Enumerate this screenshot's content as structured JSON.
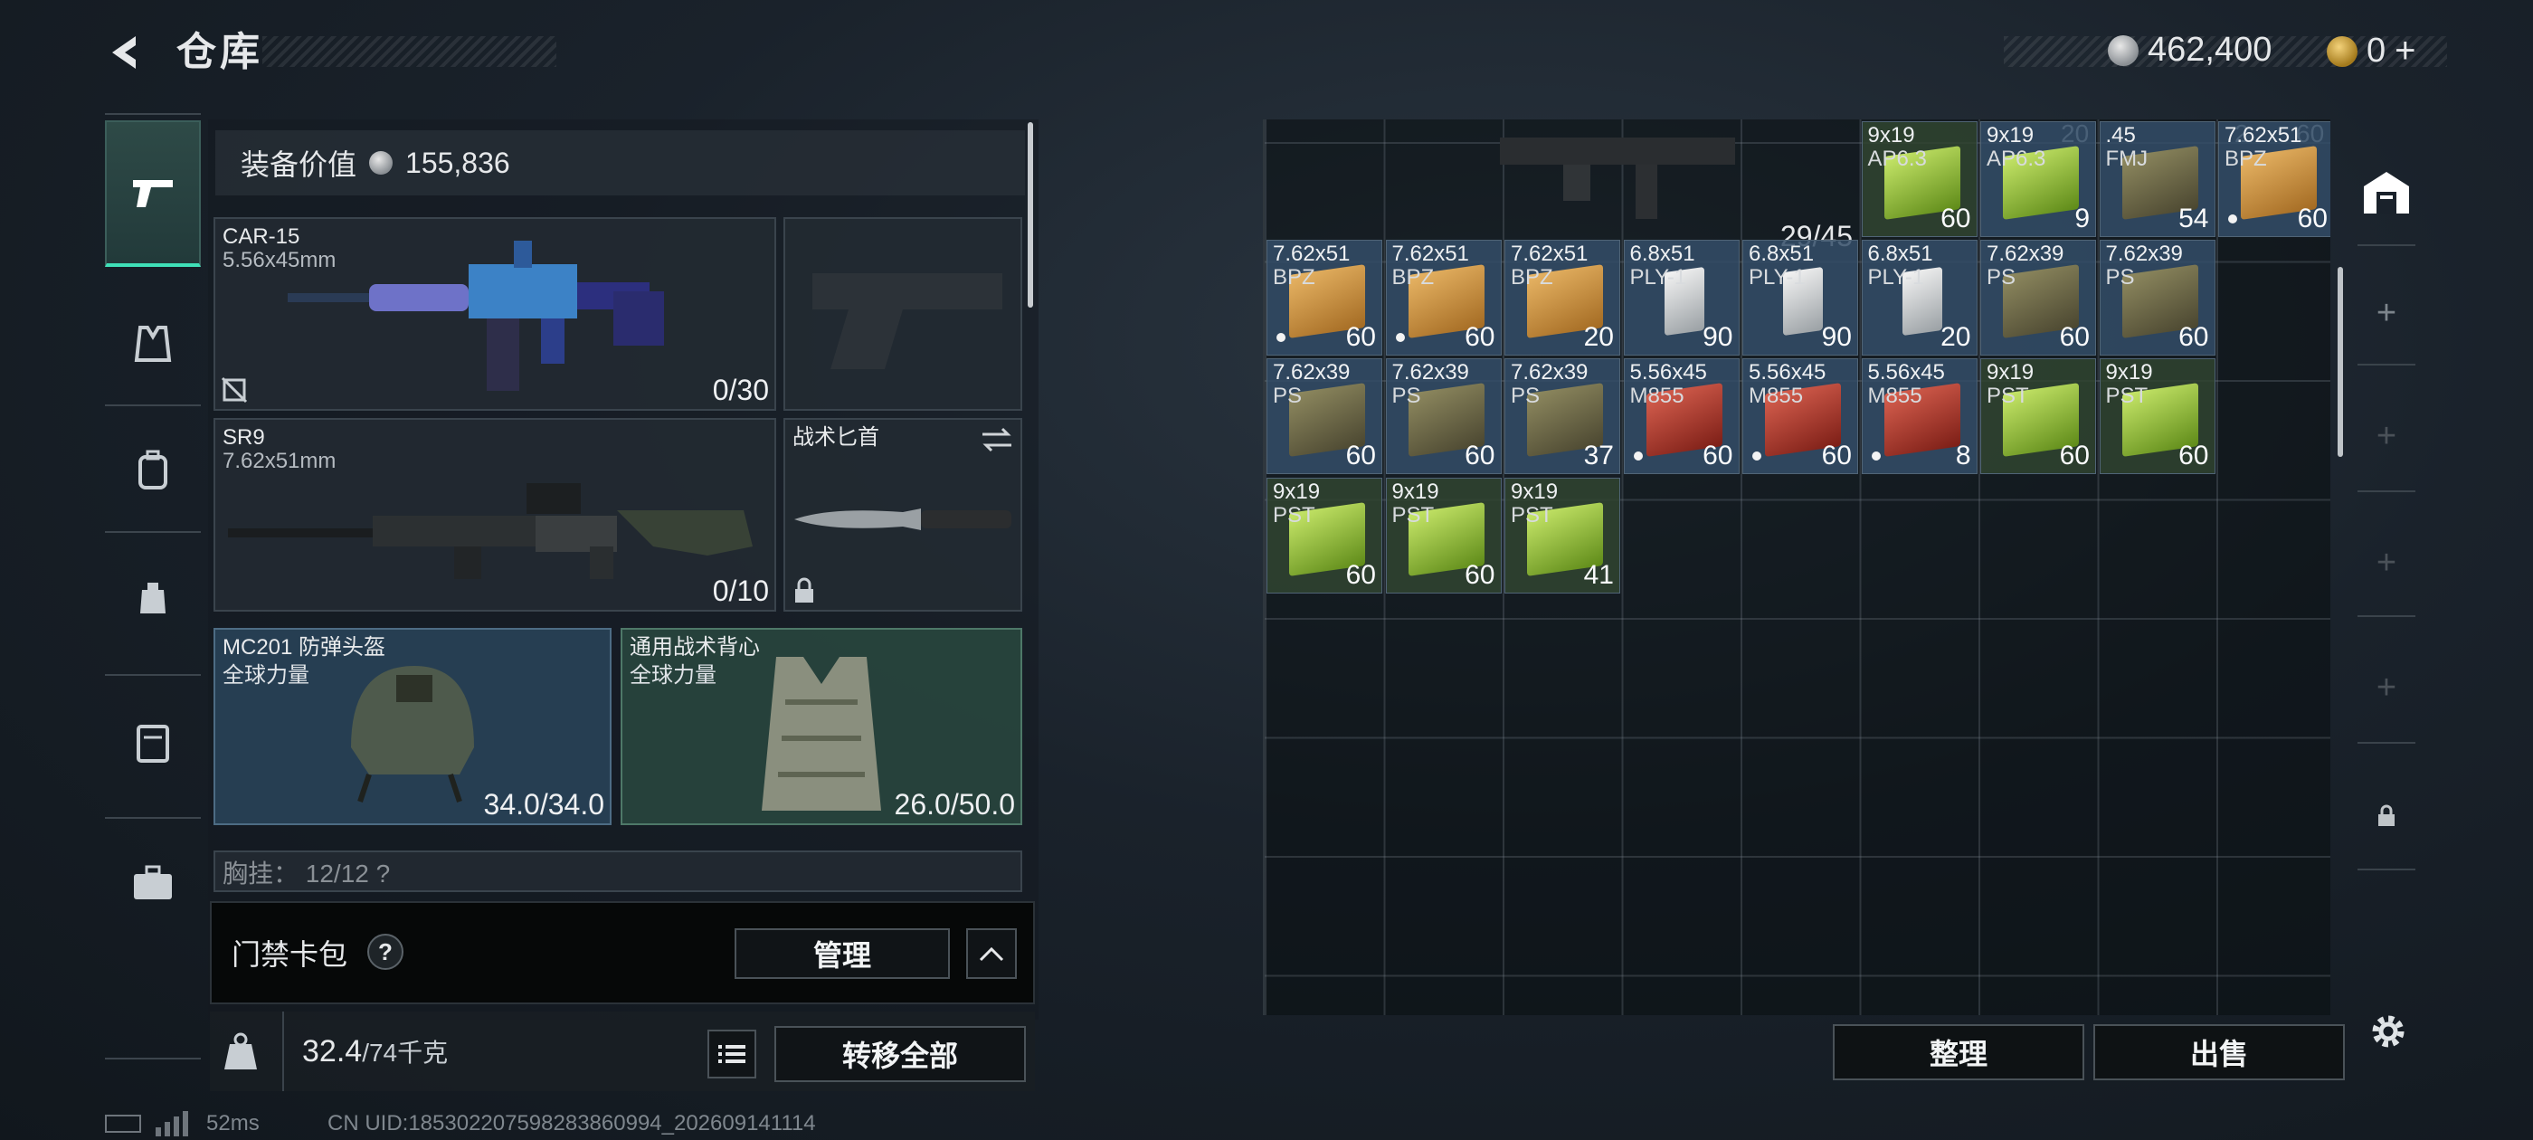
{
  "header": {
    "title": "仓库",
    "silver_amount": "462,400",
    "gold_amount": "0"
  },
  "nav": {
    "items": [
      "weapons",
      "armor",
      "backpack",
      "chest-rig",
      "case",
      "toolbox"
    ]
  },
  "equipment": {
    "value_label": "装备价值",
    "value": "155,836",
    "primary1": {
      "name": "CAR-15",
      "caliber": "5.56x45mm",
      "ammo": "0/30"
    },
    "primary2": {
      "name": "SR9",
      "caliber": "7.62x51mm",
      "ammo": "0/10"
    },
    "melee": {
      "name": "战术匕首"
    },
    "helmet": {
      "name": "MC201 防弹头盔",
      "faction": "全球力量",
      "durability": "34.0/34.0"
    },
    "vest": {
      "name": "通用战术背心",
      "faction": "全球力量",
      "durability": "26.0/50.0"
    },
    "chest_rig_partial": "胸挂： 12/12  ?"
  },
  "card_pack": {
    "label": "门禁卡包",
    "help": "?",
    "manage_label": "管理"
  },
  "weight": {
    "current": "32.4",
    "max": "/74千克",
    "transfer_label": "转移全部",
    "weight_icon_text": "KG"
  },
  "storage": {
    "top_counts": [
      "20",
      "2",
      "60"
    ],
    "container_count": "29/45",
    "items": [
      {
        "cal": "9x19",
        "typ": "AP6.3",
        "qty": "60",
        "color": "green",
        "bg": "green",
        "dot": false
      },
      {
        "cal": "9x19",
        "typ": "AP6.3",
        "qty": "9",
        "color": "green",
        "bg": "blue",
        "dot": false
      },
      {
        "cal": ".45",
        "typ": "FMJ",
        "qty": "54",
        "color": "olive",
        "bg": "blue",
        "dot": false
      },
      {
        "cal": "7.62x51",
        "typ": "BPZ",
        "qty": "60",
        "color": "tan",
        "bg": "blue",
        "dot": true
      },
      {
        "cal": "7.62x51",
        "typ": "BPZ",
        "qty": "60",
        "color": "tan",
        "bg": "blue",
        "dot": true
      },
      {
        "cal": "7.62x51",
        "typ": "BPZ",
        "qty": "60",
        "color": "tan",
        "bg": "blue",
        "dot": true
      },
      {
        "cal": "7.62x51",
        "typ": "BPZ",
        "qty": "20",
        "color": "tan",
        "bg": "blue",
        "dot": false
      },
      {
        "cal": "6.8x51",
        "typ": "PLY-1",
        "qty": "90",
        "color": "white",
        "bg": "blue",
        "dot": false
      },
      {
        "cal": "6.8x51",
        "typ": "PLY-1",
        "qty": "90",
        "color": "white",
        "bg": "blue",
        "dot": false
      },
      {
        "cal": "6.8x51",
        "typ": "PLY-1",
        "qty": "20",
        "color": "white",
        "bg": "blue",
        "dot": false
      },
      {
        "cal": "7.62x39",
        "typ": "PS",
        "qty": "60",
        "color": "olive",
        "bg": "blue",
        "dot": false
      },
      {
        "cal": "7.62x39",
        "typ": "PS",
        "qty": "60",
        "color": "olive",
        "bg": "blue",
        "dot": false
      },
      {
        "cal": "7.62x39",
        "typ": "PS",
        "qty": "60",
        "color": "olive",
        "bg": "blue",
        "dot": false
      },
      {
        "cal": "7.62x39",
        "typ": "PS",
        "qty": "60",
        "color": "olive",
        "bg": "blue",
        "dot": false
      },
      {
        "cal": "7.62x39",
        "typ": "PS",
        "qty": "37",
        "color": "olive",
        "bg": "blue",
        "dot": false
      },
      {
        "cal": "5.56x45",
        "typ": "M855",
        "qty": "60",
        "color": "red",
        "bg": "blue",
        "dot": true
      },
      {
        "cal": "5.56x45",
        "typ": "M855",
        "qty": "60",
        "color": "red",
        "bg": "blue",
        "dot": true
      },
      {
        "cal": "5.56x45",
        "typ": "M855",
        "qty": "8",
        "color": "red",
        "bg": "blue",
        "dot": true
      },
      {
        "cal": "9x19",
        "typ": "PST",
        "qty": "60",
        "color": "green",
        "bg": "green",
        "dot": false
      },
      {
        "cal": "9x19",
        "typ": "PST",
        "qty": "60",
        "color": "green",
        "bg": "green",
        "dot": false
      },
      {
        "cal": "9x19",
        "typ": "PST",
        "qty": "60",
        "color": "green",
        "bg": "green",
        "dot": false
      },
      {
        "cal": "9x19",
        "typ": "PST",
        "qty": "60",
        "color": "green",
        "bg": "green",
        "dot": false
      },
      {
        "cal": "9x19",
        "typ": "PST",
        "qty": "41",
        "color": "green",
        "bg": "green",
        "dot": false
      }
    ],
    "sort_label": "整理",
    "sell_label": "出售"
  },
  "status_bar": {
    "ping": "52ms",
    "uid": "CN UID:185302207598283860994_202609141114"
  },
  "colors": {
    "accent": "#3fe0b8",
    "panel": "#222a32",
    "helmet_bg": "#2c4258",
    "vest_bg": "#2a463e"
  }
}
